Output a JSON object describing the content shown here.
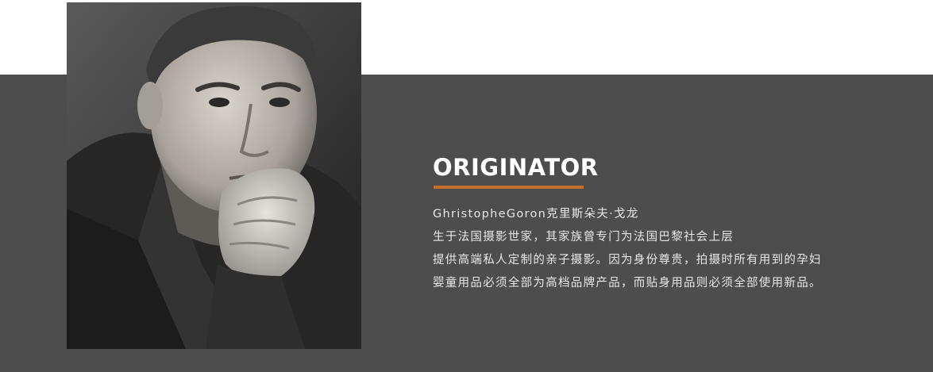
{
  "colors": {
    "page_bg": "#ffffff",
    "band_bg": "#4d4d4d",
    "accent": "#c8702b",
    "heading": "#ffffff",
    "body_text": "#e9e9e9"
  },
  "portrait": {
    "kind": "black-and-white photograph of a man resting his chin on his hand"
  },
  "section": {
    "heading": "ORIGINATOR",
    "lines": [
      "GhristopheGoron克里斯朵夫·戈龙",
      "生于法国摄影世家，其家族曾专门为法国巴黎社会上层",
      "提供高端私人定制的亲子摄影。因为身份尊贵，拍摄时所有用到的孕妇",
      "婴童用品必须全部为高档品牌产品，而贴身用品则必须全部使用新品。"
    ]
  }
}
